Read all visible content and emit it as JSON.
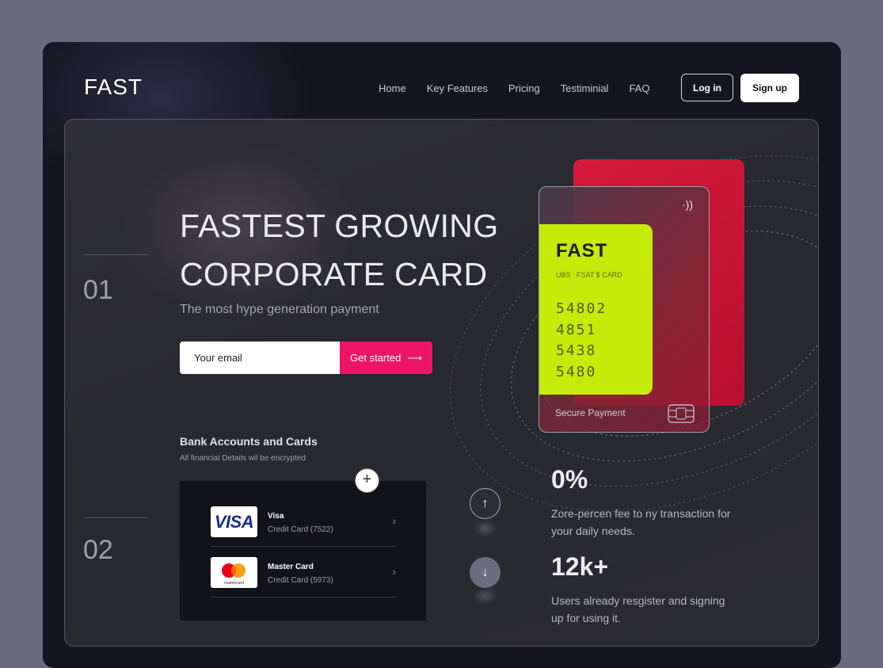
{
  "logo": "FAST",
  "nav": [
    "Home",
    "Key Features",
    "Pricing",
    "Testiminial",
    "FAQ"
  ],
  "auth": {
    "login": "Log in",
    "signup": "Sign up"
  },
  "hero": {
    "step": "01",
    "title_line1": "FASTEST GROWING",
    "title_line2": "CORPORATE CARD",
    "subtitle": "The most hype generation payment",
    "email_placeholder": "Your email",
    "cta": "Get started",
    "cta_icon": "arrow-right-icon"
  },
  "bank": {
    "step": "02",
    "title": "Bank Accounts and Cards",
    "subtitle": "All financial Details wil be encrypted",
    "add_icon": "plus-icon",
    "accounts": [
      {
        "logo_text": "VISA",
        "name": "Visa",
        "detail": "Credit Card (7522)"
      },
      {
        "logo_text": "mastercard",
        "name": "Master Card",
        "detail": "Credit Card (5973)"
      }
    ]
  },
  "card": {
    "brand": "FAST",
    "sub": "UBS : FSAT $ CARD",
    "numbers": [
      "54802",
      "4851",
      "5438",
      "5480"
    ],
    "footer": "Secure Payment",
    "nfc_icon": "contactless-icon",
    "chip_icon": "chip-icon",
    "colors": {
      "lime": "#c6eb0b",
      "red": "#d51a3c",
      "accent": "#ee1466"
    }
  },
  "stats": [
    {
      "value": "0%",
      "desc": "Zore-percen fee to ny transaction for your daily needs."
    },
    {
      "value": "12k+",
      "desc": "Users already resgister and signing up for using it."
    }
  ],
  "scroll": {
    "up_icon": "arrow-up-icon",
    "down_icon": "arrow-down-icon"
  }
}
